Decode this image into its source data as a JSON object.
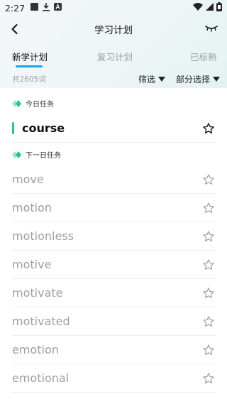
{
  "status_bar": {
    "time": "2:27",
    "icons": [
      "square-notification-icon",
      "download-icon",
      "a-badge-icon",
      "wifi-icon",
      "signal-icon",
      "battery-icon"
    ]
  },
  "header": {
    "title": "学习计划",
    "back_icon": "chevron-left-icon",
    "right_icon": "closed-eye-icon"
  },
  "tabs": [
    {
      "label": "新学计划",
      "active": true
    },
    {
      "label": "复习计划",
      "active": false
    },
    {
      "label": "已标熟",
      "active": false
    }
  ],
  "filter_bar": {
    "count": "共2605词",
    "filter_label": "筛选",
    "select_label": "部分选择"
  },
  "sections": {
    "today": "今日任务",
    "next": "下一日任务"
  },
  "today_words": [
    "course"
  ],
  "next_words": [
    "move",
    "motion",
    "motionless",
    "motive",
    "motivate",
    "motivated",
    "emotion",
    "emotional"
  ],
  "colors": {
    "accent_green": "#20c68a",
    "tab_underline": "#1aa3e8",
    "muted_text": "#9aa0a6"
  }
}
